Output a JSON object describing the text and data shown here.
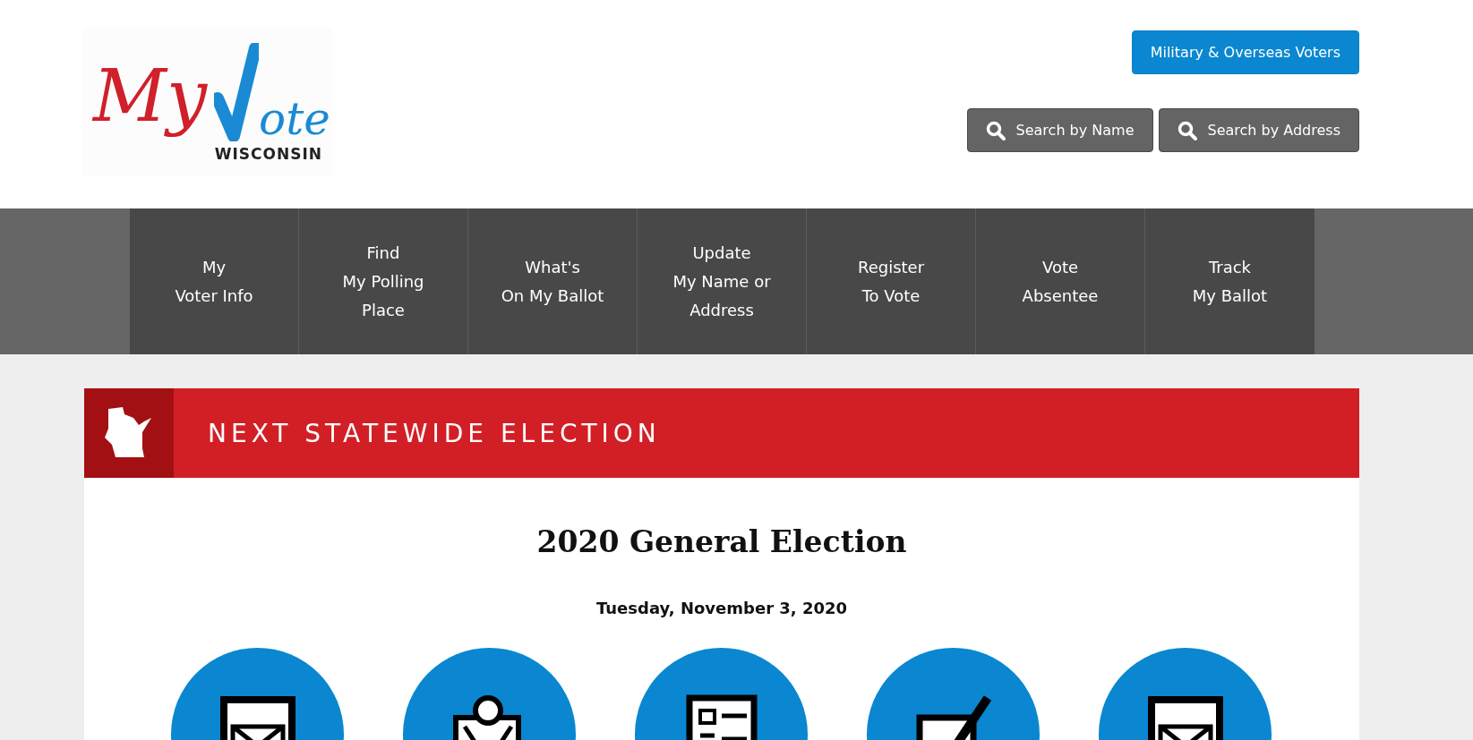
{
  "logo": {
    "script": "My",
    "check_word": "ote",
    "state": "WISCONSIN"
  },
  "header_buttons": [
    {
      "label": "Military & Overseas Voters",
      "kind": "primary"
    },
    {
      "label": "Search by Name",
      "kind": "search"
    },
    {
      "label": "Search by Address",
      "kind": "search"
    }
  ],
  "nav": [
    {
      "lines": [
        "My",
        "Voter Info"
      ]
    },
    {
      "lines": [
        "Find",
        "My Polling",
        "Place"
      ]
    },
    {
      "lines": [
        "What's",
        "On My Ballot"
      ]
    },
    {
      "lines": [
        "Update",
        "My Name or",
        "Address"
      ]
    },
    {
      "lines": [
        "Register",
        "To Vote"
      ]
    },
    {
      "lines": [
        "Vote",
        "Absentee"
      ]
    },
    {
      "lines": [
        "Track",
        "My Ballot"
      ]
    }
  ],
  "election_panel": {
    "heading": "NEXT STATEWIDE ELECTION",
    "title": "2020 General Election",
    "date": "Tuesday, November 3, 2020",
    "icons": [
      {
        "kind": "envelope"
      },
      {
        "kind": "person"
      },
      {
        "kind": "document"
      },
      {
        "kind": "checkbox"
      },
      {
        "kind": "envelope"
      }
    ]
  }
}
